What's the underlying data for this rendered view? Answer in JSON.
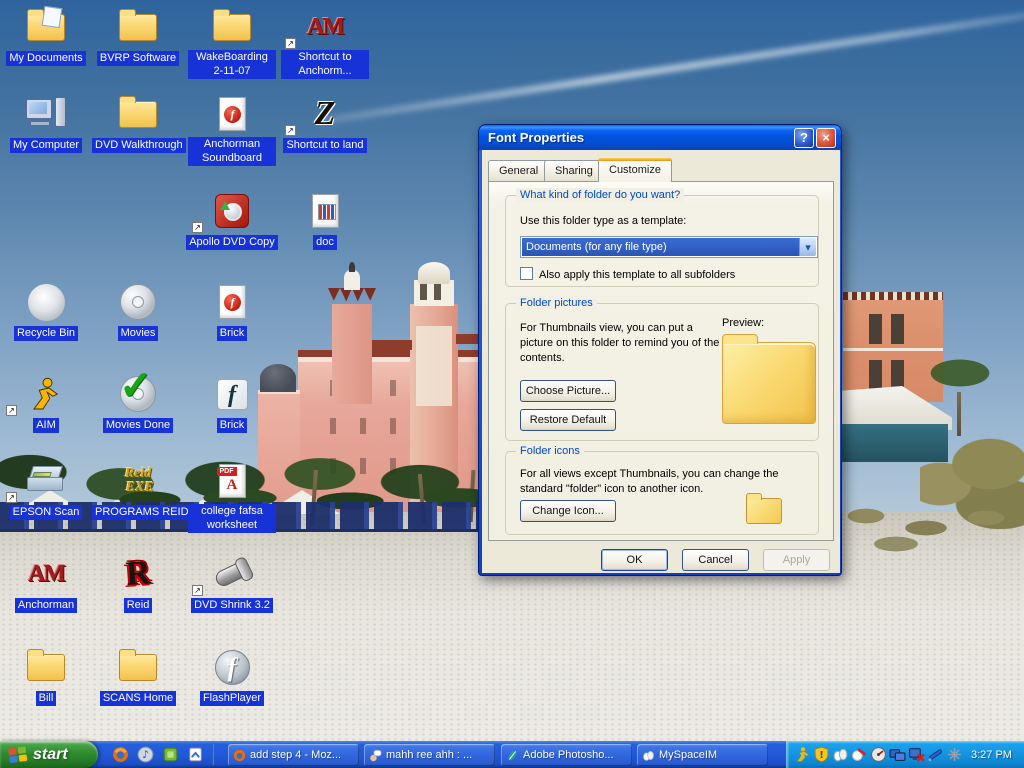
{
  "desktop": {
    "icons": [
      {
        "label": "My Documents",
        "icon": "folder-documents"
      },
      {
        "label": "BVRP Software",
        "icon": "folder"
      },
      {
        "label": "WakeBoarding 2-11-07",
        "icon": "folder"
      },
      {
        "label": "Shortcut to Anchorm...",
        "icon": "anchorman-am-logo-shortcut"
      },
      {
        "label": "My Computer",
        "icon": "my-computer"
      },
      {
        "label": "DVD Walkthrough",
        "icon": "folder"
      },
      {
        "label": "Anchorman Soundboard",
        "icon": "flash-document"
      },
      {
        "label": "Shortcut to land",
        "icon": "z-logo-shortcut"
      },
      {
        "label": "Apollo DVD Copy",
        "icon": "dvd-copy-shortcut"
      },
      {
        "label": "doc",
        "icon": "document-page"
      },
      {
        "label": "Recycle Bin",
        "icon": "sphere"
      },
      {
        "label": "Movies",
        "icon": "cd-disc"
      },
      {
        "label": "Brick",
        "icon": "flash-document"
      },
      {
        "label": "AIM",
        "icon": "aim-running-man-shortcut"
      },
      {
        "label": "Movies Done",
        "icon": "cd-disc-checkmark"
      },
      {
        "label": "Brick",
        "icon": "flash-installer"
      },
      {
        "label": "EPSON Scan",
        "icon": "scanner-shortcut"
      },
      {
        "label": "PROGRAMS REID",
        "icon": "reid-exe-gold-text"
      },
      {
        "label": "college fafsa worksheet",
        "icon": "pdf-document"
      },
      {
        "label": "Anchorman",
        "icon": "anchorman-am-logo"
      },
      {
        "label": "Reid",
        "icon": "grunge-r-logo"
      },
      {
        "label": "DVD Shrink 3.2",
        "icon": "film-scroll-shortcut"
      },
      {
        "label": "Bill",
        "icon": "folder"
      },
      {
        "label": "SCANS Home",
        "icon": "folder"
      },
      {
        "label": "FlashPlayer",
        "icon": "flash-sphere"
      }
    ]
  },
  "dialog": {
    "title": "Font Properties",
    "tabs": [
      {
        "label": "General"
      },
      {
        "label": "Sharing"
      },
      {
        "label": "Customize",
        "active": true
      }
    ],
    "template_group": {
      "caption": "What kind of folder do you want?",
      "label": "Use this folder type as a template:",
      "combo_value": "Documents (for any file type)",
      "checkbox_label": "Also apply this template to all subfolders",
      "checkbox_checked": false
    },
    "pictures_group": {
      "caption": "Folder pictures",
      "body": "For Thumbnails view, you can put a picture on this folder to remind you of the contents.",
      "choose_button": "Choose Picture...",
      "restore_button": "Restore Default",
      "preview_label": "Preview:"
    },
    "icons_group": {
      "caption": "Folder icons",
      "body": "For all views except Thumbnails, you can change the standard \"folder\" icon to another icon.",
      "change_button": "Change Icon..."
    },
    "buttons": {
      "ok": "OK",
      "cancel": "Cancel",
      "apply": "Apply",
      "apply_disabled": true
    }
  },
  "taskbar": {
    "start_label": "start",
    "quick_launch": [
      {
        "icon": "firefox"
      },
      {
        "icon": "itunes"
      },
      {
        "icon": "limewire"
      },
      {
        "icon": "outlook-express"
      }
    ],
    "tasks": [
      {
        "icon": "firefox",
        "label": "add step 4 - Moz..."
      },
      {
        "icon": "aim-chat-hand",
        "label": "mahh ree ahh : ..."
      },
      {
        "icon": "photoshop-feather",
        "label": "Adobe Photosho..."
      },
      {
        "icon": "myspace-hands",
        "label": "MySpaceIM",
        "active": true
      }
    ],
    "tray": {
      "icons": [
        "aim-man",
        "security-shield",
        "myspace-hands",
        "cleaning-tool",
        "speed-gauge",
        "network-computers",
        "network-disconnected",
        "pen-tablet",
        "asterisk"
      ],
      "clock": "3:27 PM"
    }
  },
  "colors": {
    "icon_label_bg": "#1733d8",
    "titlebar_blue": "#0353e0",
    "dialog_bg": "#ece9d8",
    "groupbox_caption_blue": "#0046d5",
    "taskbar_blue": "#2159d8",
    "tray_blue": "#1494e0",
    "start_green": "#2f8b2f",
    "combo_selection_blue": "#2a55b4",
    "sky_top": "#2f649e",
    "sand": "#e8e6df",
    "hotel_pink": "#e7a79a"
  }
}
